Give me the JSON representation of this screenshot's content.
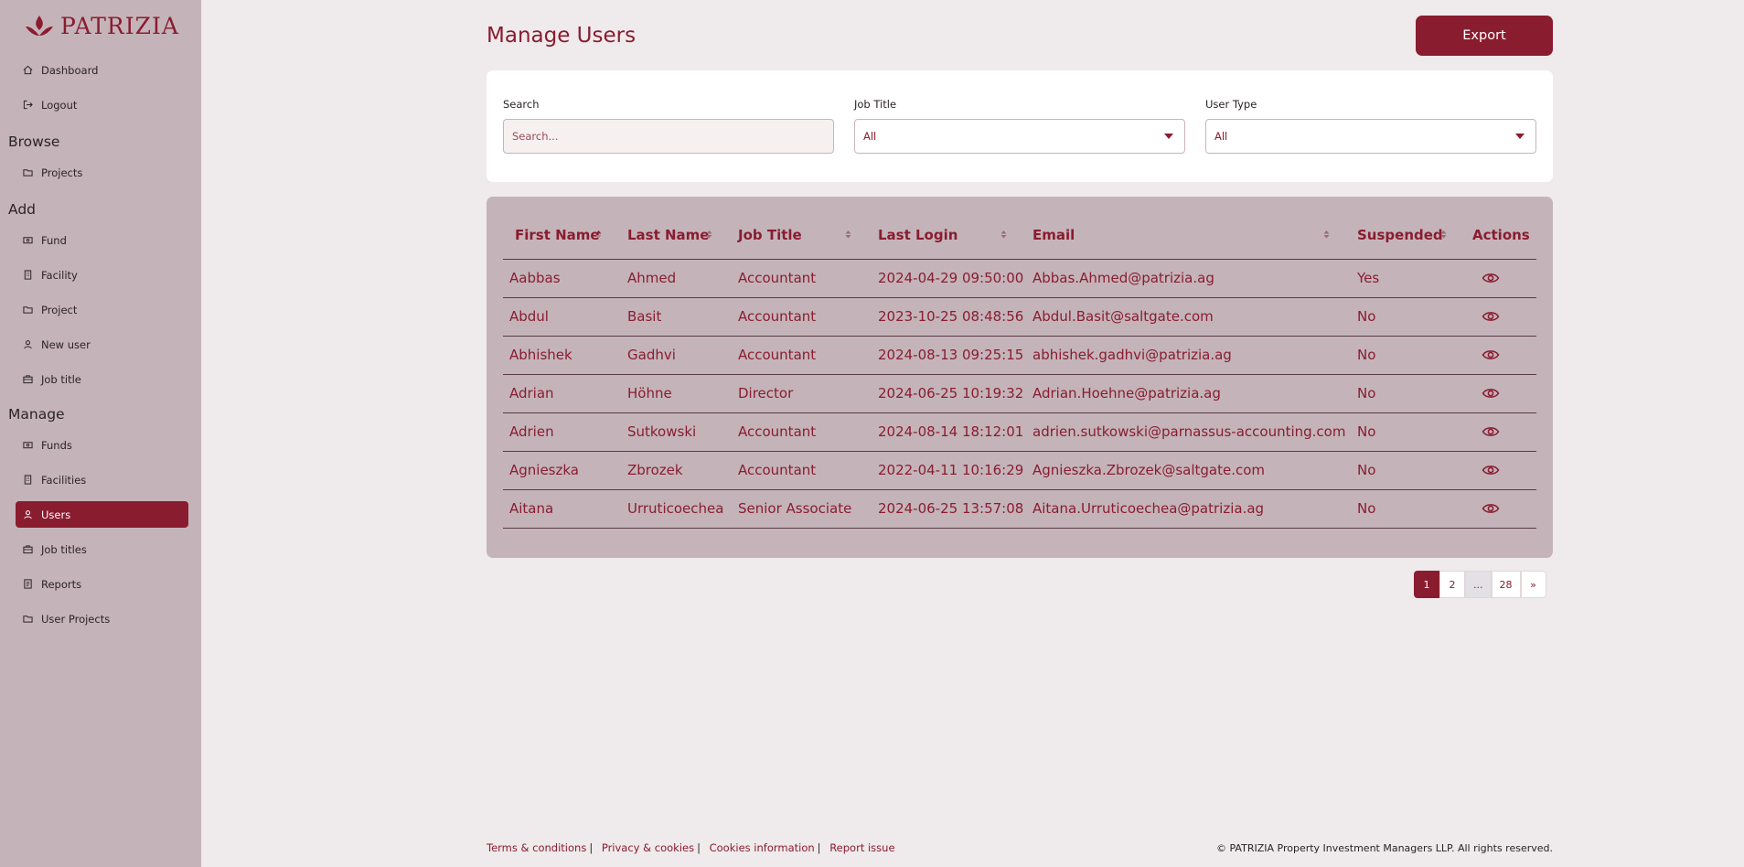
{
  "brand": {
    "name": "PATRIZIA",
    "color": "#8a1c30"
  },
  "sidebar": {
    "top_items": [
      {
        "label": "Dashboard",
        "icon": "home-icon"
      },
      {
        "label": "Logout",
        "icon": "logout-icon"
      }
    ],
    "sections": [
      {
        "title": "Browse",
        "items": [
          {
            "label": "Projects",
            "icon": "folder-icon"
          }
        ]
      },
      {
        "title": "Add",
        "items": [
          {
            "label": "Fund",
            "icon": "money-icon"
          },
          {
            "label": "Facility",
            "icon": "building-icon"
          },
          {
            "label": "Project",
            "icon": "folder-icon"
          },
          {
            "label": "New user",
            "icon": "user-icon"
          },
          {
            "label": "Job title",
            "icon": "briefcase-icon"
          }
        ]
      },
      {
        "title": "Manage",
        "items": [
          {
            "label": "Funds",
            "icon": "money-icon"
          },
          {
            "label": "Facilities",
            "icon": "building-icon"
          },
          {
            "label": "Users",
            "icon": "user-icon",
            "active": true
          },
          {
            "label": "Job titles",
            "icon": "briefcase-icon"
          },
          {
            "label": "Reports",
            "icon": "report-icon"
          },
          {
            "label": "User Projects",
            "icon": "folder-icon"
          }
        ]
      }
    ]
  },
  "header": {
    "title": "Manage Users",
    "export_label": "Export"
  },
  "filters": {
    "search": {
      "label": "Search",
      "placeholder": "Search..."
    },
    "job_title": {
      "label": "Job Title",
      "value": "All"
    },
    "user_type": {
      "label": "User Type",
      "value": "All"
    }
  },
  "table": {
    "columns": [
      "First Name",
      "Last Name",
      "Job Title",
      "Last Login",
      "Email",
      "Suspended",
      "Actions"
    ],
    "rows": [
      [
        "Aabbas",
        "Ahmed",
        "Accountant",
        "2024-04-29 09:50:00",
        "Abbas.Ahmed@patrizia.ag",
        "Yes"
      ],
      [
        "Abdul",
        "Basit",
        "Accountant",
        "2023-10-25 08:48:56",
        "Abdul.Basit@saltgate.com",
        "No"
      ],
      [
        "Abhishek",
        "Gadhvi",
        "Accountant",
        "2024-08-13 09:25:15",
        "abhishek.gadhvi@patrizia.ag",
        "No"
      ],
      [
        "Adrian",
        "Höhne",
        "Director",
        "2024-06-25 10:19:32",
        "Adrian.Hoehne@patrizia.ag",
        "No"
      ],
      [
        "Adrien",
        "Sutkowski",
        "Accountant",
        "2024-08-14 18:12:01",
        "adrien.sutkowski@parnassus-accounting.com",
        "No"
      ],
      [
        "Agnieszka",
        "Zbrozek",
        "Accountant",
        "2022-04-11 10:16:29",
        "Agnieszka.Zbrozek@saltgate.com",
        "No"
      ],
      [
        "Aitana",
        "Urruticoechea",
        "Senior Associate",
        "2024-06-25 13:57:08",
        "Aitana.Urruticoechea@patrizia.ag",
        "No"
      ]
    ]
  },
  "pagination": {
    "pages": [
      "1",
      "2",
      "...",
      "28",
      "»"
    ],
    "current": "1"
  },
  "footer": {
    "links": [
      "Terms & conditions",
      "Privacy & cookies",
      "Cookies information",
      "Report issue"
    ],
    "copyright": "© PATRIZIA Property Investment Managers LLP. All rights reserved."
  }
}
